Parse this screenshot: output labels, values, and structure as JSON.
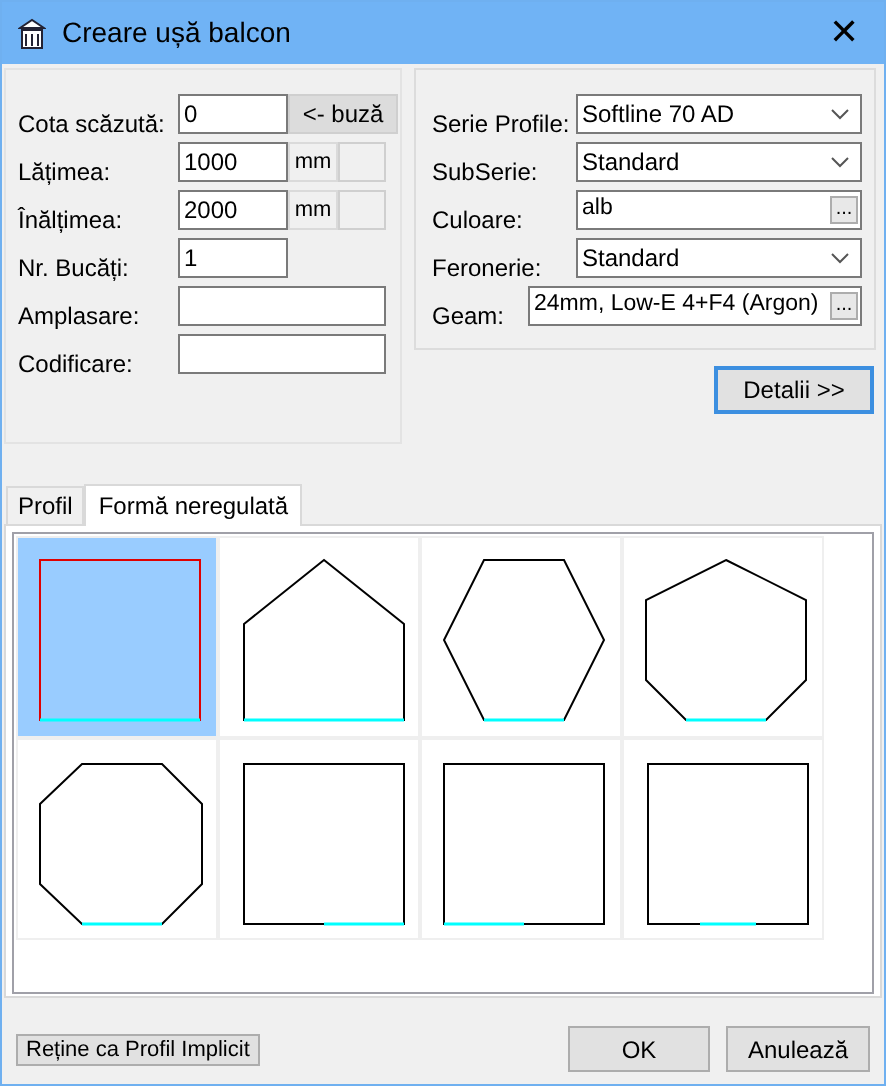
{
  "window": {
    "title": "Creare ușă balcon",
    "close": "✕"
  },
  "left_fields": [
    {
      "label": "Cota scăzută:",
      "value": "0",
      "kind": "button",
      "button": "<- buză"
    },
    {
      "label": "Lățimea:",
      "value": "1000",
      "kind": "unit",
      "unit": "mm"
    },
    {
      "label": "Înălțimea:",
      "value": "2000",
      "kind": "unit",
      "unit": "mm"
    },
    {
      "label": "Nr. Bucăți:",
      "value": "1",
      "kind": "short"
    },
    {
      "label": "Amplasare:",
      "kind": "plain"
    },
    {
      "label": "Codificare:",
      "kind": "plain"
    }
  ],
  "right_fields": [
    {
      "label": "Serie Profile:",
      "value": "Softline 70 AD",
      "kind": "dropdown"
    },
    {
      "label": "SubSerie:",
      "value": "Standard",
      "kind": "dropdown"
    },
    {
      "label": "Culoare:",
      "value": "alb",
      "kind": "picker",
      "button": "..."
    },
    {
      "label": "Feronerie:",
      "value": "Standard",
      "kind": "dropdown"
    },
    {
      "label": "Geam:",
      "value": "24mm, Low-E 4+F4 (Argon)",
      "kind": "picker",
      "button": "..."
    }
  ],
  "details_button": "Detalii >>",
  "tabs": [
    {
      "label": "Profil",
      "selected": false
    },
    {
      "label": "Formă neregulată",
      "selected": true
    }
  ],
  "shapes": [
    {
      "kind": "square-full",
      "selected": true
    },
    {
      "kind": "pentagon",
      "selected": false
    },
    {
      "kind": "hexagon",
      "selected": false
    },
    {
      "kind": "heptagon",
      "selected": false
    },
    {
      "kind": "octagon",
      "selected": false
    },
    {
      "kind": "square-right",
      "selected": false
    },
    {
      "kind": "square-left",
      "selected": false
    },
    {
      "kind": "square-center",
      "selected": false
    }
  ],
  "buttons": {
    "set_default": "Reține ca Profil Implicit",
    "ok": "OK",
    "cancel": "Anulează"
  }
}
